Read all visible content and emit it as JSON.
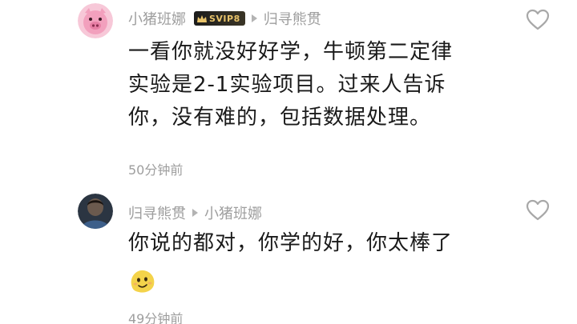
{
  "comments": [
    {
      "author": "小猪班娜",
      "badge": "SVIP8",
      "reply_to": "归寻熊贯",
      "text_lines": [
        "一看你就没好好学，牛顿第二定律",
        "实验是2-1实验项目。过来人告诉",
        "你，没有难的，包括数据处理。"
      ],
      "time": "50分钟前",
      "avatar_icon": "pink-pig-avatar",
      "like_icon": "heart-outline-icon"
    },
    {
      "author": "归寻熊贯",
      "reply_to": "小猪班娜",
      "text_lines": [
        "你说的都对，你学的好，你太棒了"
      ],
      "emoji_icon": "yellow-blob-emoji-icon",
      "time": "49分钟前",
      "avatar_icon": "dark-photo-avatar",
      "like_icon": "heart-outline-icon"
    }
  ],
  "colors": {
    "meta_text": "#9e9e9e",
    "body_text": "#1a1a1a",
    "badge_text": "#e8c36a",
    "background": "#ffffff"
  }
}
